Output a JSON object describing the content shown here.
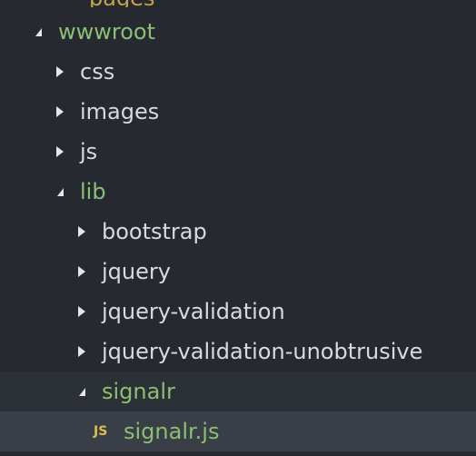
{
  "tree": {
    "clipped_top_label": "pages",
    "items": [
      {
        "label": "wwwroot",
        "state": "expanded",
        "kind": "folder"
      },
      {
        "label": "css",
        "state": "collapsed",
        "kind": "folder"
      },
      {
        "label": "images",
        "state": "collapsed",
        "kind": "folder"
      },
      {
        "label": "js",
        "state": "collapsed",
        "kind": "folder"
      },
      {
        "label": "lib",
        "state": "expanded",
        "kind": "folder"
      },
      {
        "label": "bootstrap",
        "state": "collapsed",
        "kind": "folder"
      },
      {
        "label": "jquery",
        "state": "collapsed",
        "kind": "folder"
      },
      {
        "label": "jquery-validation",
        "state": "collapsed",
        "kind": "folder"
      },
      {
        "label": "jquery-validation-unobtrusive",
        "state": "collapsed",
        "kind": "folder"
      },
      {
        "label": "signalr",
        "state": "expanded",
        "kind": "folder"
      },
      {
        "label": "signalr.js",
        "kind": "file",
        "badge": "JS",
        "selected": true
      }
    ]
  },
  "colors": {
    "background": "#262a30",
    "expanded_folder_text": "#8bbf73",
    "text": "#d7dae0",
    "js_badge": "#d8c04a",
    "selection": "#3a3e46"
  }
}
